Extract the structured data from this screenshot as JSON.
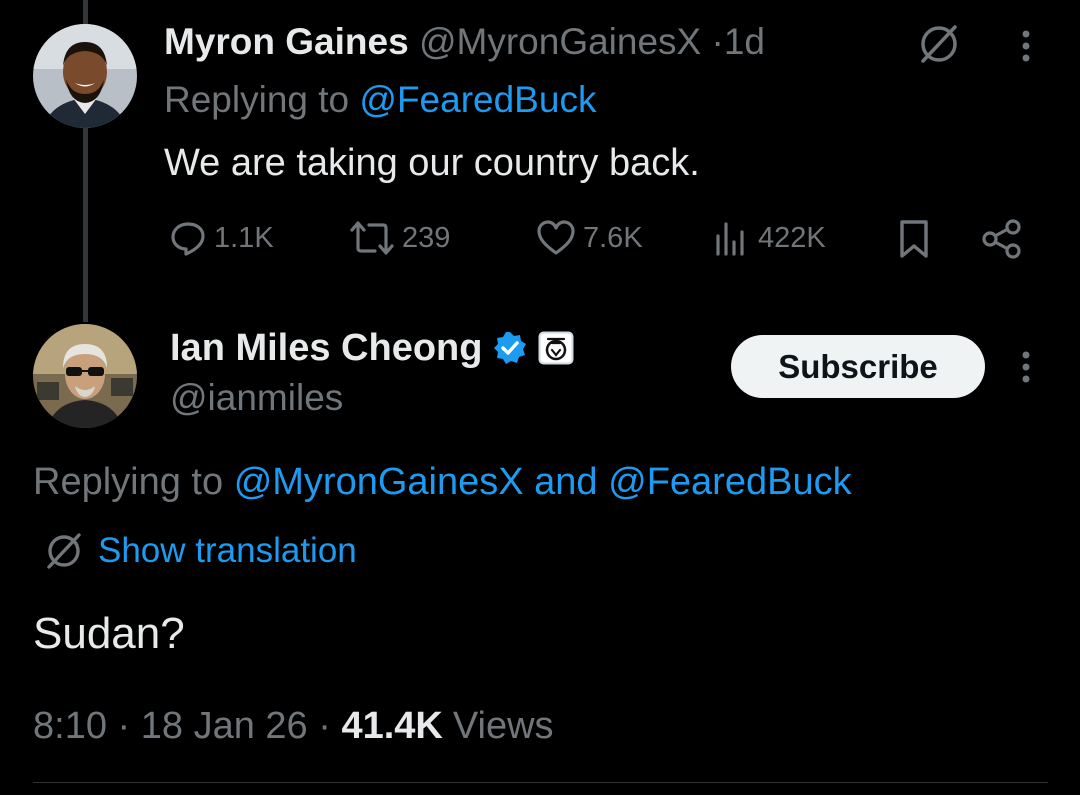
{
  "reply_tweet": {
    "author_name": "Myron Gaines",
    "handle": "@MyronGainesX",
    "separator": "·",
    "time_ago": "1d",
    "replying_prefix": "Replying to",
    "replying_to": "@FearedBuck",
    "text": "We are taking our country back.",
    "stats": {
      "replies": "1.1K",
      "reposts": "239",
      "likes": "7.6K",
      "views": "422K"
    },
    "icons": [
      "globe-slash-icon",
      "more-icon",
      "reply-icon",
      "repost-icon",
      "like-icon",
      "views-icon",
      "bookmark-icon",
      "share-icon"
    ]
  },
  "main_tweet": {
    "author_name": "Ian Miles Cheong",
    "handle": "@ianmiles",
    "subscribe_label": "Subscribe",
    "replying_prefix": "Replying to",
    "replying_to_1": "@MyronGainesX",
    "and_word": "and",
    "replying_to_2": "@FearedBuck",
    "translation_label": "Show translation",
    "text": "Sudan?",
    "time": "8:10",
    "date": "18 Jan 26",
    "views_count": "41.4K",
    "views_label": "Views",
    "icons": [
      "verified-badge-icon",
      "affiliate-badge-icon",
      "more-icon",
      "globe-slash-icon"
    ]
  },
  "colors": {
    "background": "#000000",
    "text": "#e7e9ea",
    "muted": "#71767b",
    "link": "#1d9bf0",
    "verified": "#1d9bf0",
    "button_bg": "#eff3f4"
  }
}
